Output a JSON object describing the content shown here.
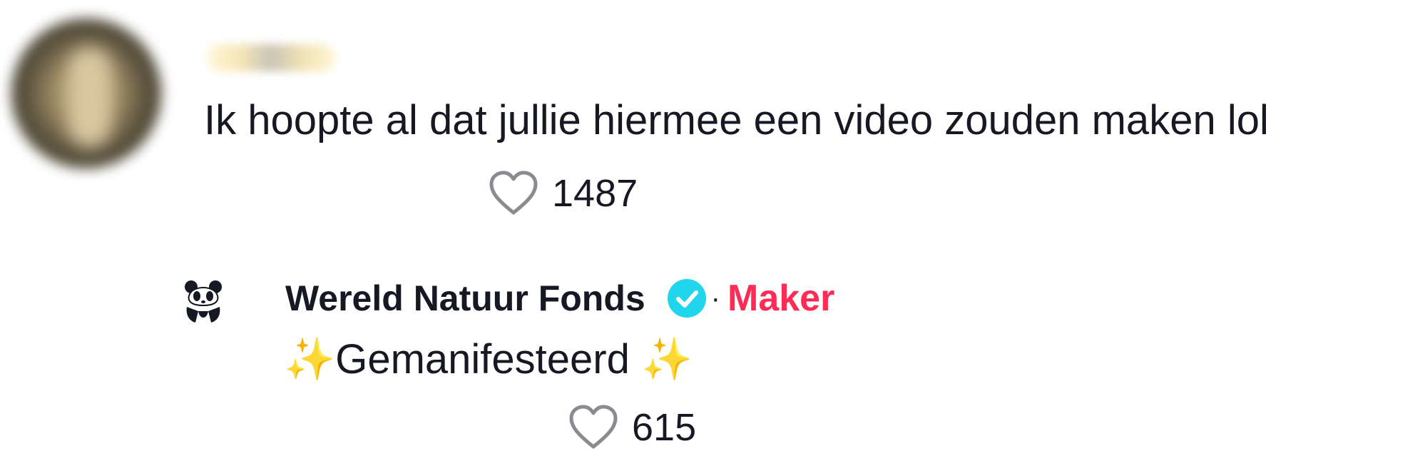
{
  "comment": {
    "text": "Ik hoopte al dat jullie hiermee een video zouden maken lol",
    "likes": "1487",
    "like_icon": "heart-outline-icon"
  },
  "reply": {
    "author": "Wereld Natuur Fonds",
    "verified_icon": "verified-badge-icon",
    "separator": "·",
    "role_label": "Maker",
    "text_prefix": "✨",
    "text": "Gemanifesteerd ",
    "text_suffix": "✨",
    "likes": "615",
    "like_icon": "heart-outline-icon"
  },
  "colors": {
    "maker": "#fe2c55",
    "verified": "#20d5ec",
    "text": "#161823",
    "heart": "#8a8b91"
  }
}
